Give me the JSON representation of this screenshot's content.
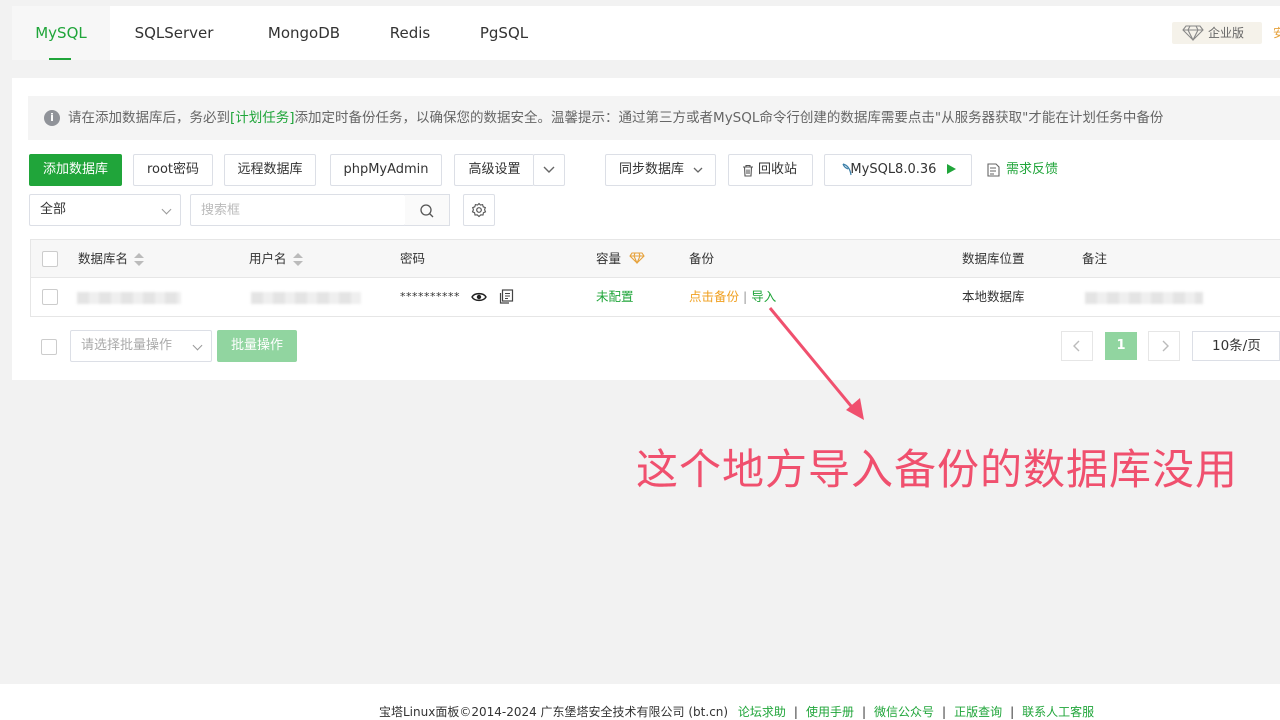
{
  "tabs": [
    {
      "label": "MySQL",
      "active": true
    },
    {
      "label": "SQLServer",
      "active": false
    },
    {
      "label": "MongoDB",
      "active": false
    },
    {
      "label": "Redis",
      "active": false
    },
    {
      "label": "PgSQL",
      "active": false
    }
  ],
  "header": {
    "enterprise_label": "企业版",
    "security_label": "安全"
  },
  "notice": {
    "text_before": "请在添加数据库后，务必到",
    "link": "[计划任务]",
    "text_after": "添加定时备份任务，以确保您的数据安全。温馨提示：通过第三方或者MySQL命令行创建的数据库需要点击\"从服务器获取\"才能在计划任务中备份"
  },
  "toolbar": {
    "add_db": "添加数据库",
    "root_pwd": "root密码",
    "remote_db": "远程数据库",
    "phpmyadmin": "phpMyAdmin",
    "advanced": "高级设置",
    "sync_db": "同步数据库",
    "recycle": "回收站",
    "mysql_version": "MySQL8.0.36",
    "feedback": "需求反馈"
  },
  "filter": {
    "category": "全部",
    "search_placeholder": "搜索框"
  },
  "table": {
    "columns": {
      "name": "数据库名",
      "user": "用户名",
      "password": "密码",
      "capacity": "容量",
      "backup": "备份",
      "location": "数据库位置",
      "remark": "备注"
    },
    "rows": [
      {
        "password": "**********",
        "capacity": "未配置",
        "backup_action": "点击备份",
        "import_action": "导入",
        "location": "本地数据库"
      }
    ]
  },
  "batch": {
    "select_placeholder": "请选择批量操作",
    "button": "批量操作"
  },
  "pagination": {
    "current": "1",
    "page_size": "10条/页"
  },
  "annotation": {
    "text": "这个地方导入备份的数据库没用"
  },
  "footer": {
    "copyright": "宝塔Linux面板©2014-2024 广东堡塔安全技术有限公司 (bt.cn)",
    "links": [
      "论坛求助",
      "使用手册",
      "微信公众号",
      "正版查询",
      "联系人工客服"
    ]
  },
  "colors": {
    "accent": "#20a53a",
    "warning": "#f0a020",
    "annotation": "#f0506e"
  }
}
